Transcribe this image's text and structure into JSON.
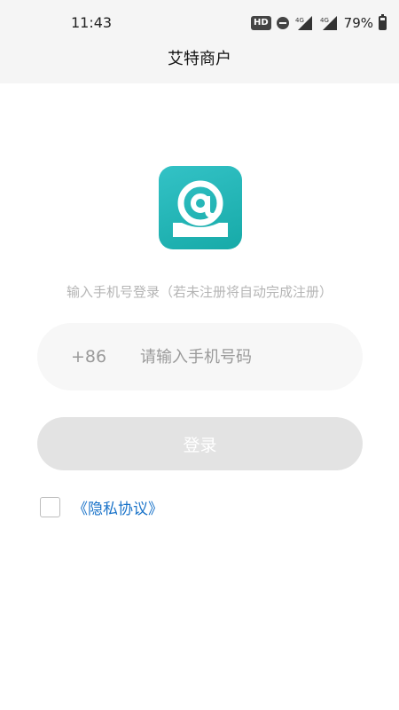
{
  "status_bar": {
    "time": "11:43",
    "hd_label": "HD",
    "network": "4G",
    "battery_percent": "79%"
  },
  "header": {
    "title": "艾特商户"
  },
  "login": {
    "hint": "输入手机号登录（若未注册将自动完成注册）",
    "country_code": "+86",
    "phone_placeholder": "请输入手机号码",
    "phone_value": "",
    "login_label": "登录",
    "privacy_label": "《隐私协议》",
    "agreed": false
  },
  "colors": {
    "brand": "#1fb5b5",
    "link": "#1a73c9",
    "disabled_button": "#e3e3e3"
  }
}
